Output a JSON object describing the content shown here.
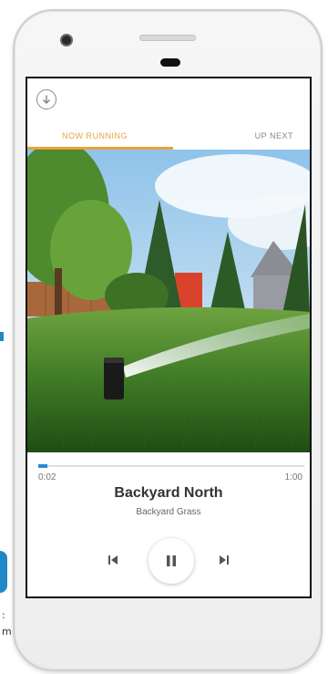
{
  "background": {
    "fragments": [
      ":",
      "m"
    ]
  },
  "player": {
    "tabs": [
      {
        "label": "NOW RUNNING",
        "active": true
      },
      {
        "label": "UP NEXT",
        "active": false
      }
    ],
    "progress": {
      "elapsed": "0:02",
      "total": "1:00",
      "fraction": 0.033
    },
    "zone_name": "Backyard North",
    "zone_type": "Backyard Grass",
    "controls": {
      "previous_icon": "skip-previous-icon",
      "pause_icon": "pause-icon",
      "next_icon": "skip-next-icon"
    },
    "top_icon": "download-circle-icon"
  },
  "colors": {
    "accent": "#e9a23b",
    "progress": "#2b8ad1"
  }
}
